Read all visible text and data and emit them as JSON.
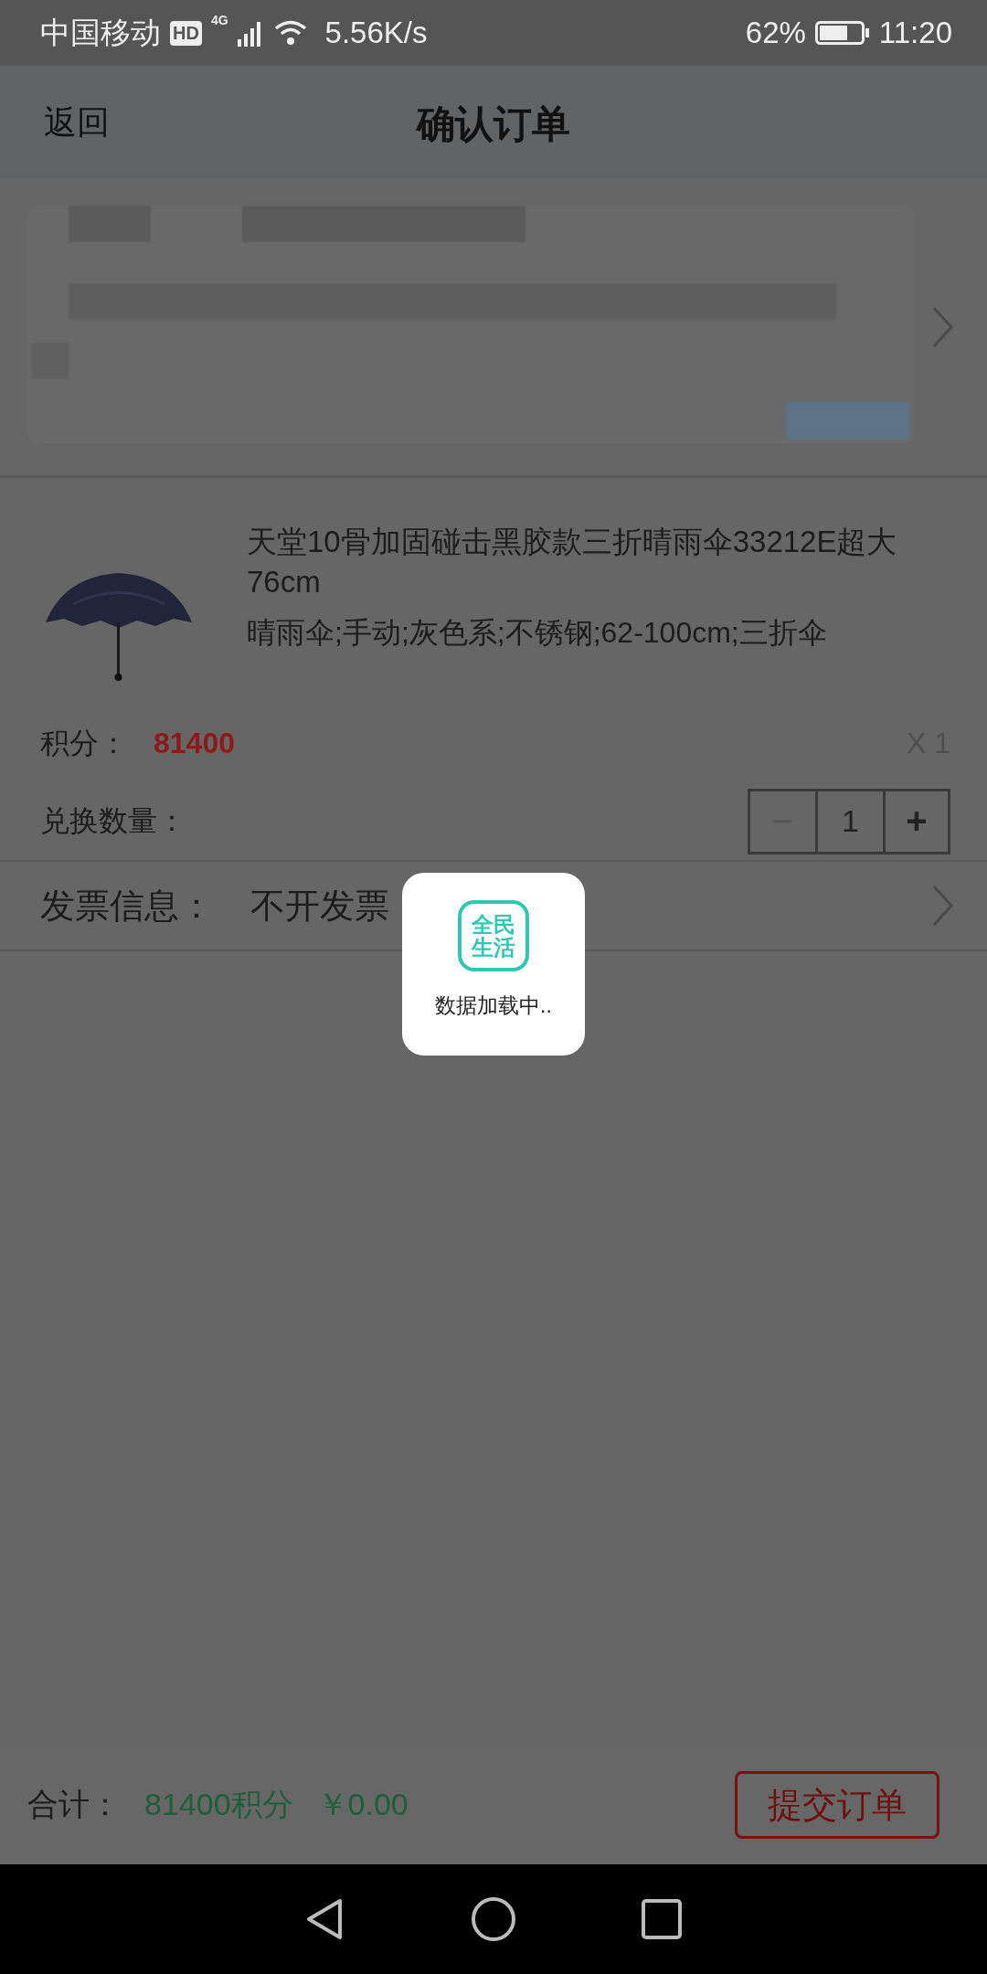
{
  "status_bar": {
    "carrier": "中国移动",
    "hd": "HD",
    "network": "4G",
    "speed": "5.56K/s",
    "battery": "62%",
    "time": "11:20"
  },
  "header": {
    "back": "返回",
    "title": "确认订单"
  },
  "product": {
    "title": "天堂10骨加固碰击黑胶款三折晴雨伞33212E超大76cm",
    "specs": "晴雨伞;手动;灰色系;不锈钢;62-100cm;三折伞",
    "points_label": "积分：",
    "points": "81400",
    "count": "X 1",
    "exchange_label": "兑换数量：",
    "stepper": [
      {
        "kind": "minus",
        "label": "−",
        "disabled": true
      },
      {
        "kind": "value",
        "label": "1"
      },
      {
        "kind": "plus",
        "label": "+",
        "disabled": false
      }
    ]
  },
  "invoice": {
    "label": "发票信息：",
    "value": "不开发票"
  },
  "loading": {
    "logo": [
      "全民",
      "生活"
    ],
    "text": "数据加载中.."
  },
  "footer": {
    "total_label": "合计：",
    "points_total": "81400积分",
    "price": "￥0.00",
    "submit": "提交订单"
  }
}
